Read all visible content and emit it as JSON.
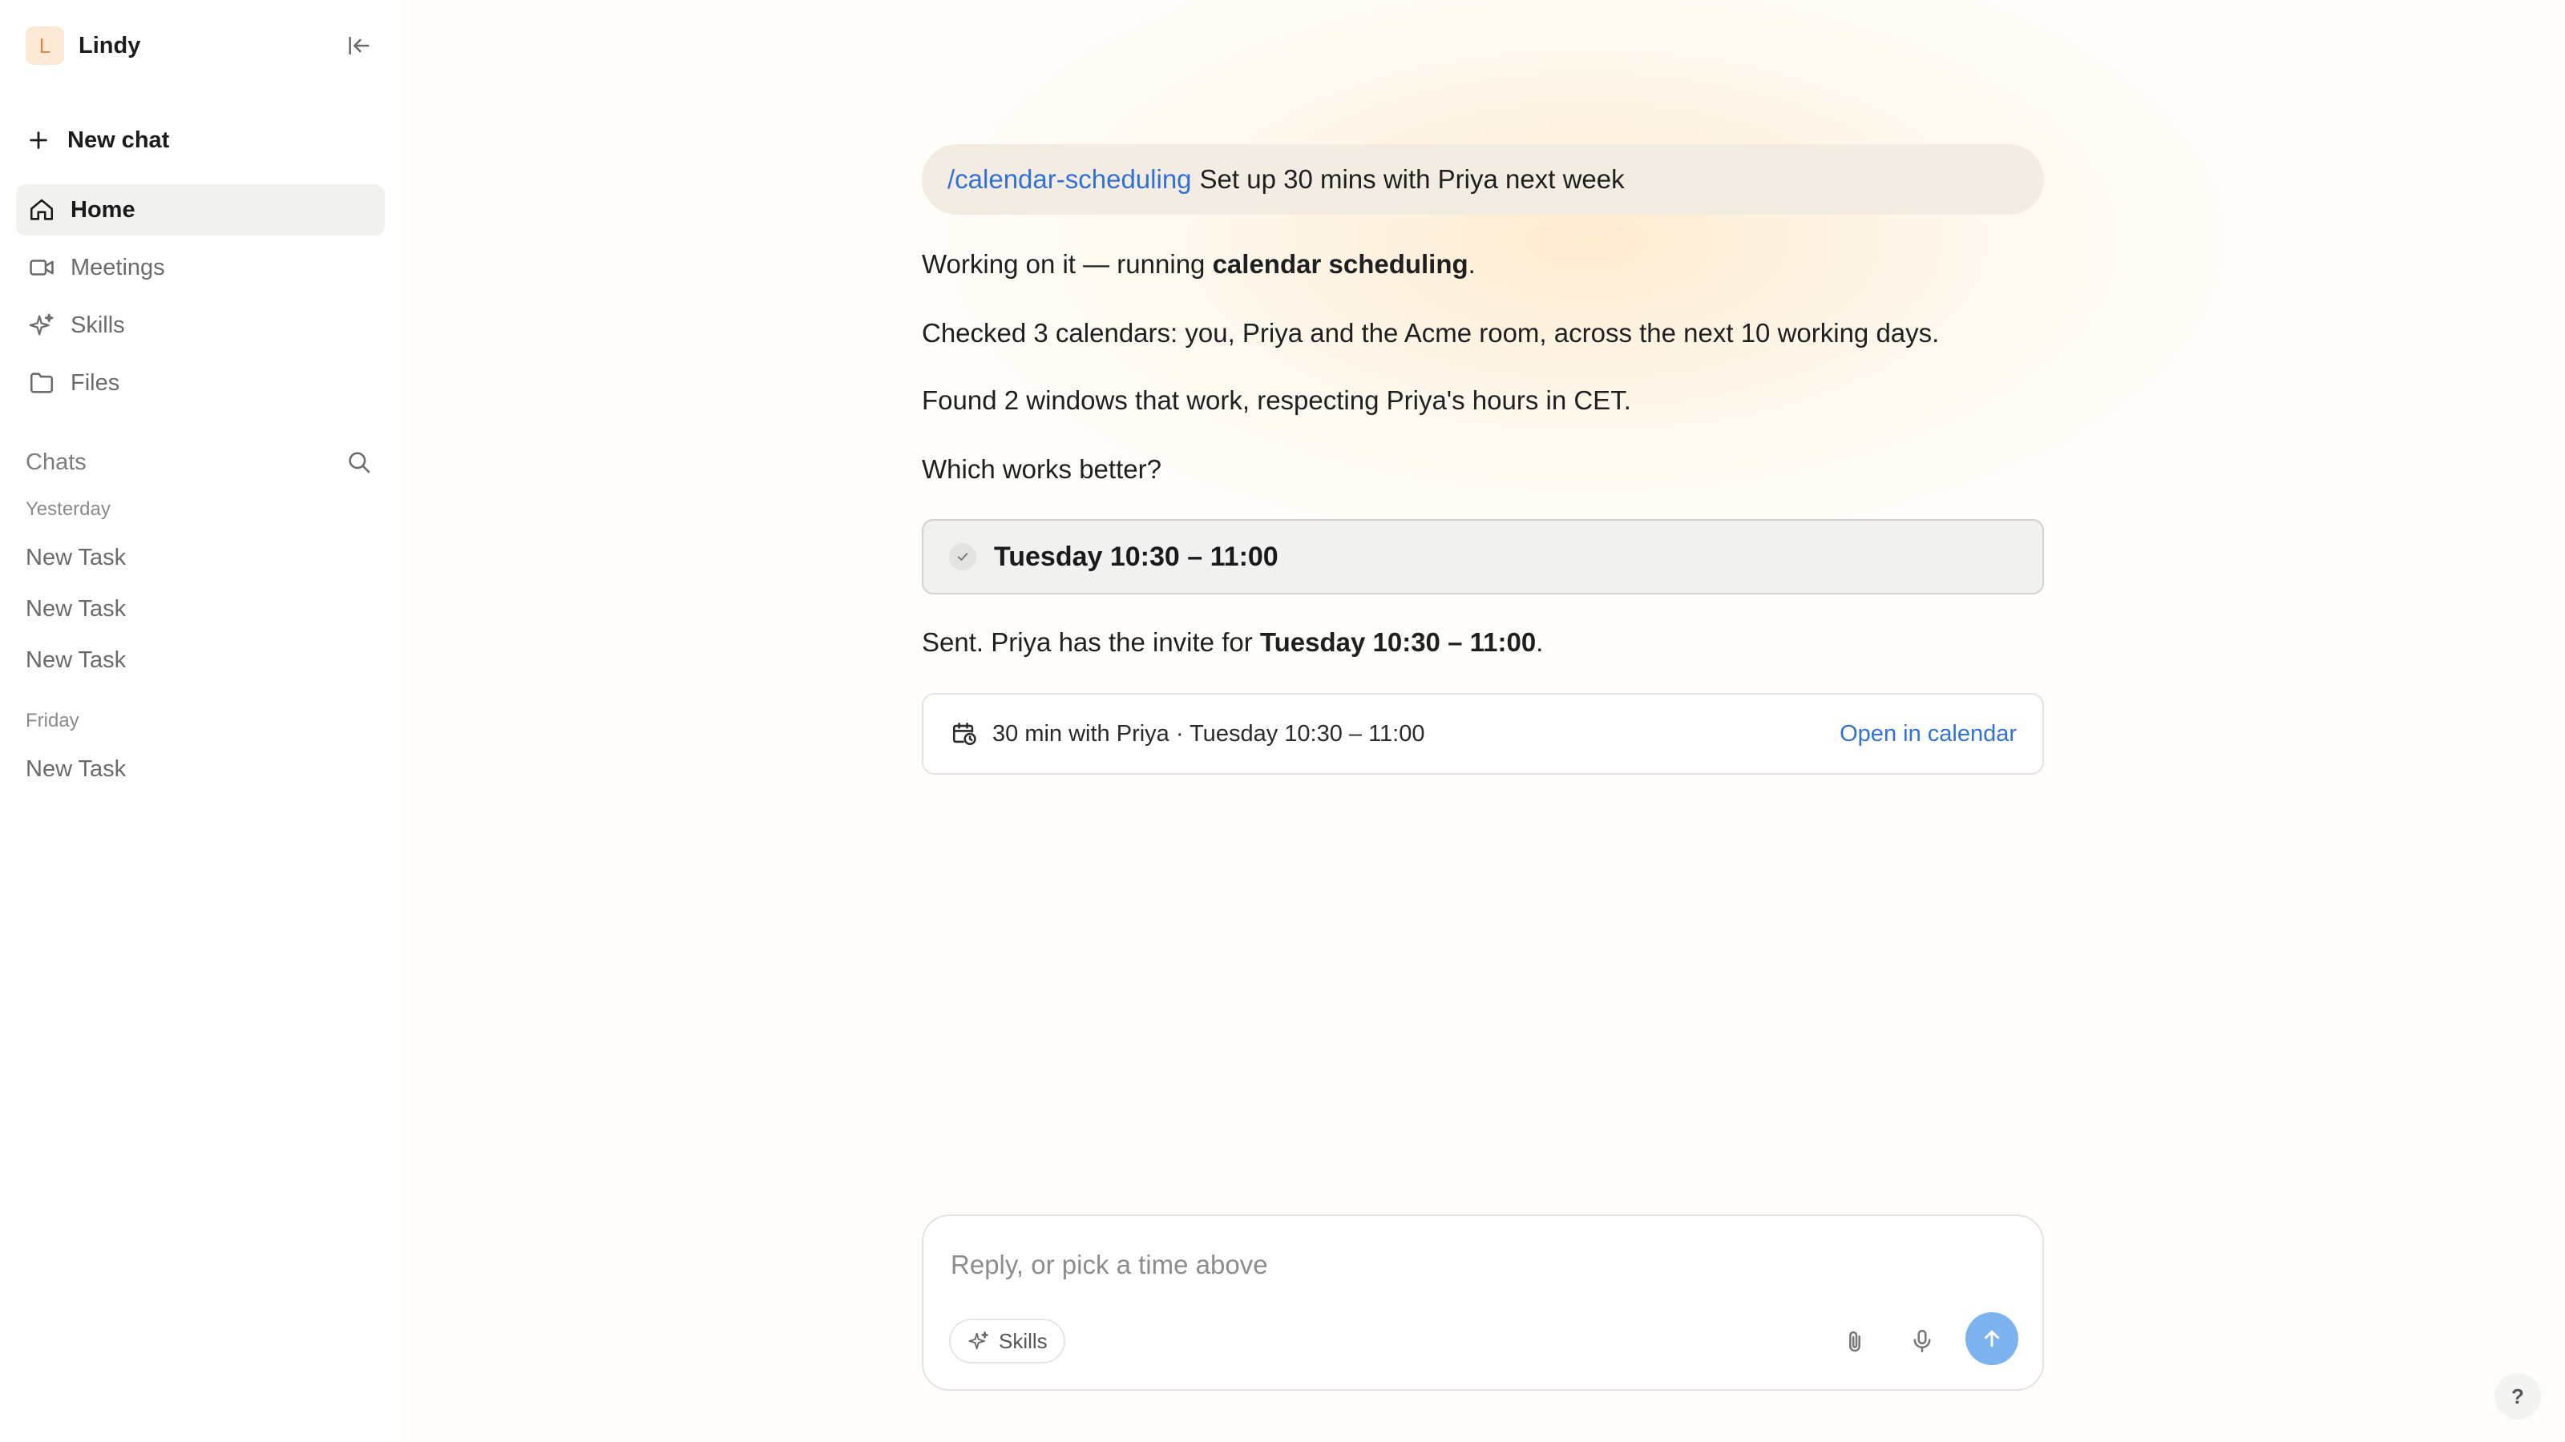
{
  "app": {
    "avatar_letter": "L",
    "name": "Lindy"
  },
  "sidebar": {
    "new_chat": "New chat",
    "nav": [
      {
        "label": "Home",
        "icon": "home-icon",
        "active": true
      },
      {
        "label": "Meetings",
        "icon": "video-icon"
      },
      {
        "label": "Skills",
        "icon": "sparkles-icon"
      },
      {
        "label": "Files",
        "icon": "folder-icon"
      }
    ],
    "chats_label": "Chats",
    "groups": [
      {
        "label": "Yesterday",
        "items": [
          "New Task",
          "New Task",
          "New Task"
        ]
      },
      {
        "label": "Friday",
        "items": [
          "New Task"
        ]
      }
    ]
  },
  "conversation": {
    "user_command": "/calendar-scheduling",
    "user_text": "Set up 30 mins with Priya next week",
    "working_prefix": "Working on it — running ",
    "working_bold": "calendar scheduling",
    "working_suffix": ".",
    "checked": "Checked 3 calendars: you, Priya and the Acme room, across the next 10 working days.",
    "found": "Found 2 windows that work, respecting Priya's hours in CET.",
    "question": "Which works better?",
    "choice": "Tuesday 10:30 – 11:00",
    "sent_prefix": "Sent. Priya has the invite for ",
    "sent_bold": "Tuesday 10:30 – 11:00",
    "sent_suffix": ".",
    "event_text": "30 min with Priya · Tuesday 10:30 – 11:00",
    "event_link": "Open in calendar"
  },
  "composer": {
    "placeholder": "Reply, or pick a time above",
    "value": "",
    "skills_label": "Skills"
  },
  "help_label": "?",
  "colors": {
    "accent": "#3271d8",
    "send": "#7db3ef",
    "bubble": "#f3ece2",
    "active_nav": "#f1f1ee"
  }
}
